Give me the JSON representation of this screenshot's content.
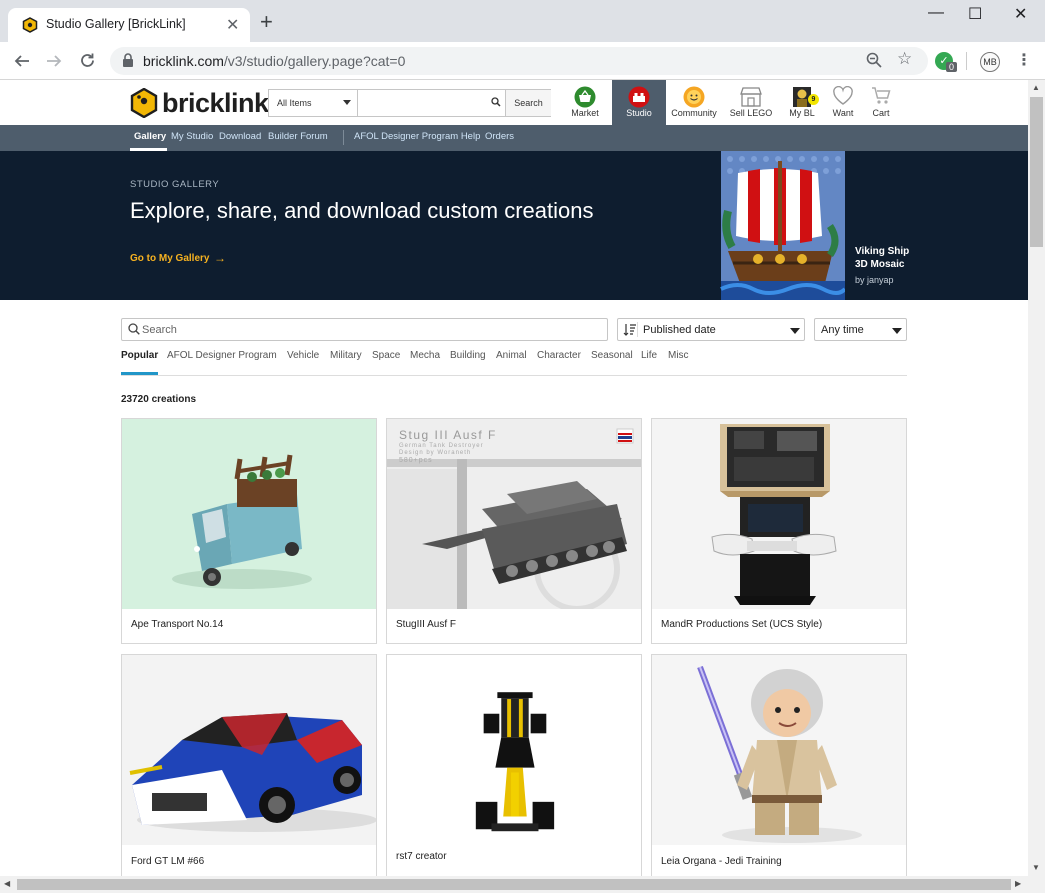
{
  "browser": {
    "tab_title": "Studio Gallery [BrickLink]",
    "url_host": "bricklink.com",
    "url_path": "/v3/studio/gallery.page?cat=0",
    "extension_badge": "0",
    "profile_initials": "MB"
  },
  "header": {
    "logo_text": "bricklink",
    "category_select": "All Items",
    "search_placeholder": "",
    "search_button": "Search",
    "nav": [
      {
        "id": "market",
        "label": "Market",
        "icon": "basket-icon"
      },
      {
        "id": "studio",
        "label": "Studio",
        "icon": "studio-brick-icon"
      },
      {
        "id": "community",
        "label": "Community",
        "icon": "smiley-icon"
      },
      {
        "id": "sell",
        "label": "Sell LEGO",
        "icon": "storefront-icon"
      },
      {
        "id": "mybl",
        "label": "My BL",
        "icon": "minifig-avatar-icon",
        "badge": "9"
      },
      {
        "id": "want",
        "label": "Want",
        "icon": "heart-icon"
      },
      {
        "id": "cart",
        "label": "Cart",
        "icon": "cart-icon"
      }
    ]
  },
  "subnav": {
    "items": [
      "Gallery",
      "My Studio",
      "Download",
      "Builder Forum",
      "AFOL Designer Program Help",
      "Orders"
    ]
  },
  "hero": {
    "eyebrow": "STUDIO GALLERY",
    "title": "Explore, share, and download custom creations",
    "cta": "Go to My Gallery",
    "featured_name_1": "Viking Ship",
    "featured_name_2": "3D Mosaic",
    "featured_author": "by janyap"
  },
  "filters": {
    "search_placeholder": "Search",
    "sort_value": "Published date",
    "time_value": "Any time",
    "categories": [
      "Popular",
      "AFOL Designer Program",
      "Vehicle",
      "Military",
      "Space",
      "Mecha",
      "Building",
      "Animal",
      "Character",
      "Seasonal",
      "Life",
      "Misc"
    ],
    "active_category": "Popular"
  },
  "results": {
    "count_text": "23720 creations"
  },
  "creations": [
    {
      "title": "Ape Transport No.14"
    },
    {
      "title": "StugIII Ausf F",
      "thumb_text_1": "Stug III Ausf F",
      "thumb_text_2": "German Tank Destroyer",
      "thumb_text_3": "Design by Woraneth",
      "thumb_text_4": "580+pcs"
    },
    {
      "title": "MandR Productions Set (UCS Style)"
    },
    {
      "title": "Ford GT LM #66"
    },
    {
      "title": "rst7 creator"
    },
    {
      "title": "Leia Organa - Jedi Training"
    }
  ],
  "colors": {
    "nav_bar": "#4e5d6c",
    "hero_bg": "#0e1d2f",
    "cta": "#f6b221",
    "tab_active": "#2196c8"
  }
}
